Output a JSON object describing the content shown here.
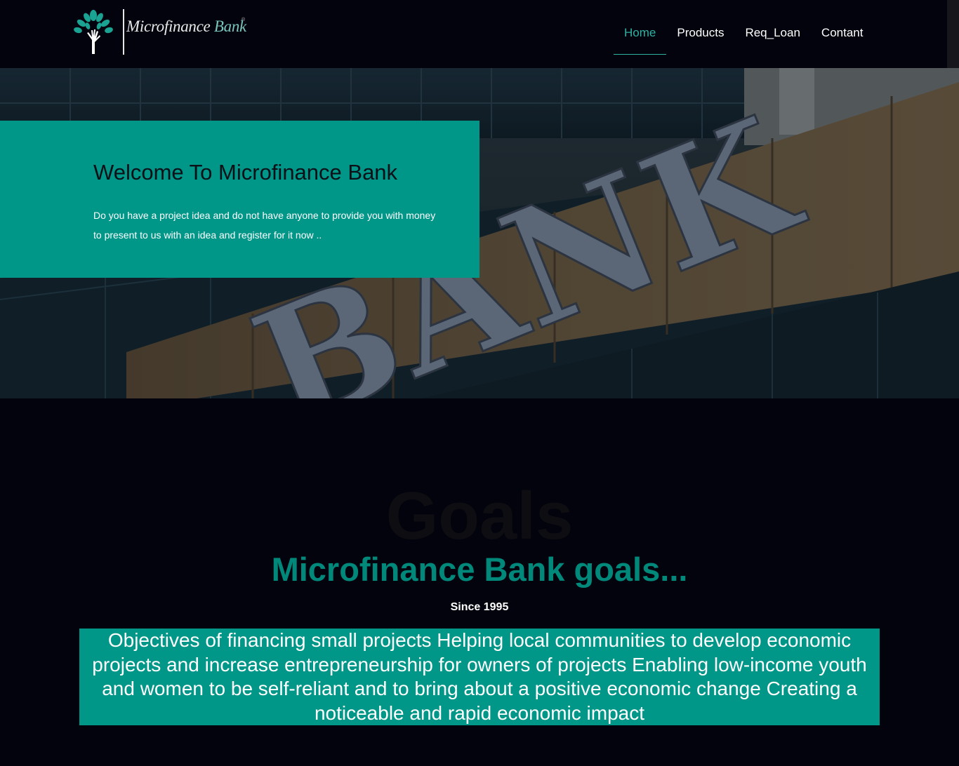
{
  "header": {
    "brand_main": "Microfinance",
    "brand_accent": " Bank",
    "trademark": "®",
    "nav": [
      {
        "label": "Home",
        "active": true
      },
      {
        "label": "Products",
        "active": false
      },
      {
        "label": "Req_Loan",
        "active": false
      },
      {
        "label": "Contant",
        "active": false
      }
    ]
  },
  "hero": {
    "sign_text": "BANK",
    "title": "Welcome To Microfinance Bank",
    "description": "Do you have a project idea and do not have anyone to provide you with money to present to us with an idea and register for it now .."
  },
  "goals": {
    "ghost_title": "Goals",
    "title": "Microfinance Bank goals...",
    "since": "Since 1995",
    "objectives": "Objectives of financing small projects Helping local communities to develop economic projects and increase entrepreneurship for owners of projects Enabling low-income youth and women to be self-reliant and to bring about a positive economic change Creating a noticeable and rapid economic impact"
  },
  "colors": {
    "accent": "#009688",
    "nav_active": "#2fb2a2",
    "background": "#03030d"
  },
  "icons": {
    "logo": "tree-hand-icon"
  }
}
